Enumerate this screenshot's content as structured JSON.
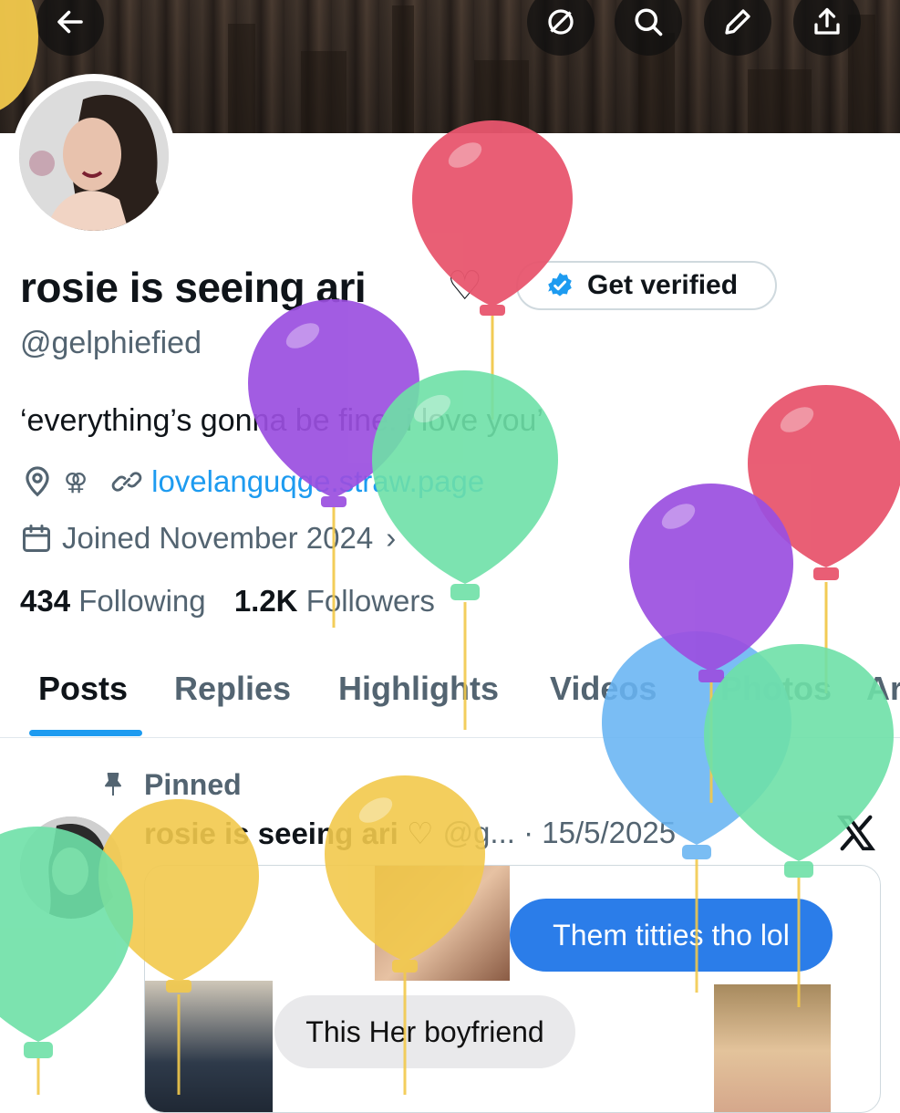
{
  "profile": {
    "name": "rosie is seeing ari",
    "heart": "♡",
    "verify_label": "Get verified",
    "handle": "@gelphiefied",
    "bio": "‘everything’s gonna be fine. i love you’",
    "location_icon": "location-pin-icon",
    "pride_symbol": "⚢",
    "website": "lovelanguqge.straw.page",
    "joined": "Joined November 2024",
    "following_count": "434",
    "following_label": "Following",
    "followers_count": "1.2K",
    "followers_label": "Followers"
  },
  "header": {
    "icons": [
      "back-arrow-icon",
      "grok-icon",
      "search-icon",
      "edit-icon",
      "share-icon"
    ]
  },
  "tabs": [
    "Posts",
    "Replies",
    "Highlights",
    "Videos",
    "Photos",
    "Ar"
  ],
  "pinned_tweet": {
    "pinned_label": "Pinned",
    "author": "rosie is seeing ari ♡",
    "handle_date": "@g... · 15/5/2025",
    "message_right": "Them titties tho lol",
    "message_left": "This Her boyfriend"
  },
  "colors": {
    "accent": "#1d9bf0",
    "balloon_red": "#e8566e",
    "balloon_purple": "#9b4fe0",
    "balloon_green": "#6ee0a7",
    "balloon_blue": "#68b4f2",
    "balloon_yellow": "#f2c94c"
  }
}
